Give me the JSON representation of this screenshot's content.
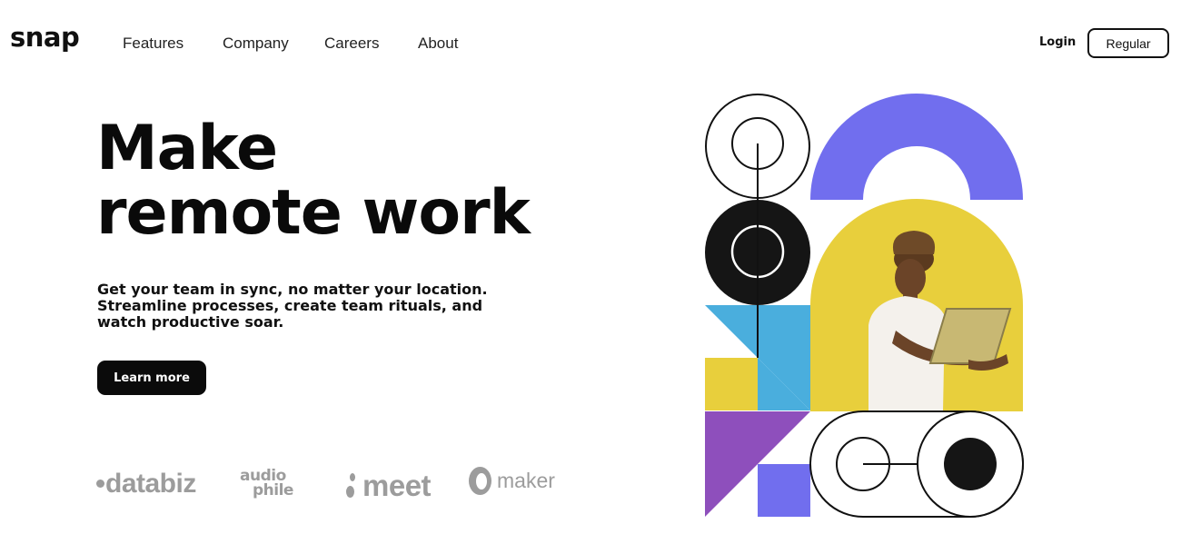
{
  "brand": {
    "logo_text": "snap"
  },
  "nav": {
    "items": [
      {
        "label": "Features"
      },
      {
        "label": "Company"
      },
      {
        "label": "Careers"
      },
      {
        "label": "About"
      }
    ]
  },
  "auth": {
    "login_label": "Login",
    "register_label": "Regular"
  },
  "hero": {
    "title_line1": "Make",
    "title_line2": "remote work",
    "subtitle_lines": [
      "Get your team in sync, no matter your location.",
      "Streamline processes, create team rituals, and",
      "watch productive soar."
    ],
    "cta_label": "Learn more"
  },
  "clients": {
    "databiz": "databiz",
    "audiophile_line1": "audio",
    "audiophile_line2": "phile",
    "meet": "meet",
    "maker": "maker"
  },
  "colors": {
    "purple": "#716EEE",
    "yellow": "#E8CF3C",
    "blue": "#4AAEDD",
    "violet": "#8E4FBC",
    "dark": "#151515",
    "client_gray": "#9C9C9C"
  },
  "illustration": {
    "icon": "geometric-hero-illustration",
    "person": "person-with-laptop-photo"
  }
}
